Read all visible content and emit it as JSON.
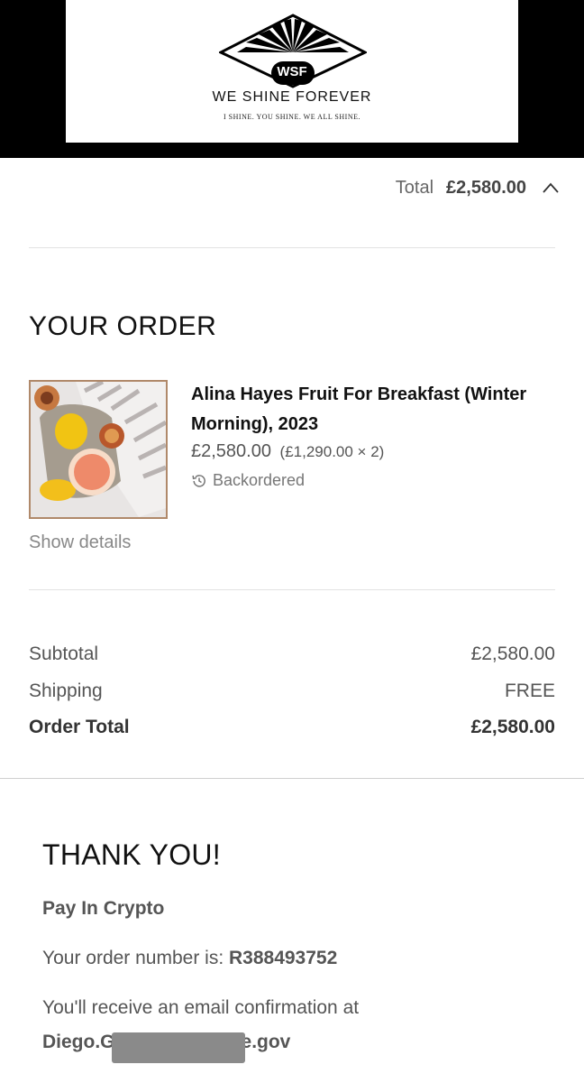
{
  "brand": {
    "logo_text": "WSF",
    "name": "WE  SHINE  FOREVER",
    "tagline": "I SHINE. YOU SHINE. WE ALL SHINE."
  },
  "summary_bar": {
    "label": "Total",
    "value": "£2,580.00",
    "icon": "chevron-up-icon"
  },
  "order": {
    "heading": "YOUR ORDER",
    "item": {
      "title": "Alina Hayes Fruit For Breakfast (Winter Morning), 2023",
      "price": "£2,580.00",
      "unit_breakdown": "(£1,290.00 × 2)",
      "status": "Backordered",
      "status_icon": "history-icon"
    },
    "show_details": "Show details"
  },
  "totals": {
    "subtotal_label": "Subtotal",
    "subtotal_value": "£2,580.00",
    "shipping_label": "Shipping",
    "shipping_value": "FREE",
    "order_total_label": "Order Total",
    "order_total_value": "£2,580.00"
  },
  "confirmation": {
    "heading": "THANK YOU!",
    "payment_method": "Pay In Crypto",
    "order_number_prefix": "Your order number is: ",
    "order_number": "R388493752",
    "email_text": "You'll receive an email confirmation at",
    "email_start": "Diego.G",
    "email_end": "e.gov"
  }
}
